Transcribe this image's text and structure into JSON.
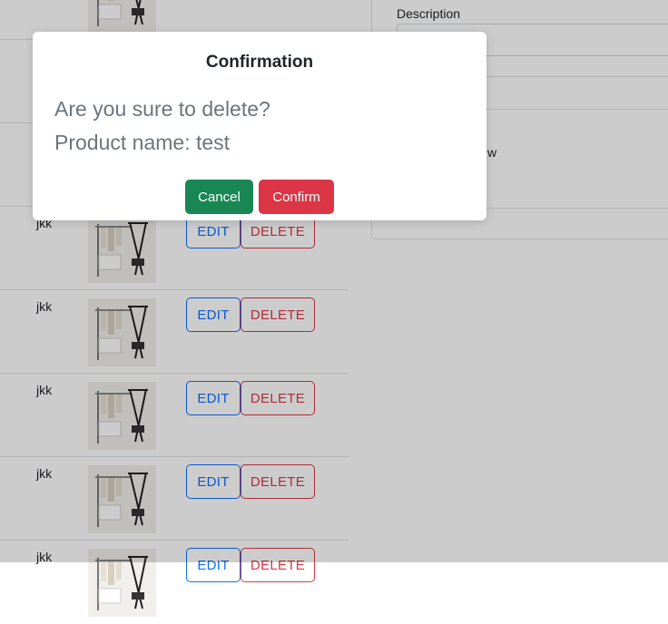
{
  "form": {
    "description_label": "Description",
    "fragment": "w"
  },
  "products": [
    {
      "name": "",
      "edit_label": "",
      "delete_label": ""
    },
    {
      "name": "",
      "edit_label": "",
      "delete_label": ""
    },
    {
      "name": "",
      "edit_label": "",
      "delete_label": ""
    },
    {
      "name": "jkk",
      "edit_label": "EDIT",
      "delete_label": "DELETE"
    },
    {
      "name": "jkk",
      "edit_label": "EDIT",
      "delete_label": "DELETE"
    },
    {
      "name": "jkk",
      "edit_label": "EDIT",
      "delete_label": "DELETE"
    },
    {
      "name": "jkk",
      "edit_label": "EDIT",
      "delete_label": "DELETE"
    },
    {
      "name": "jkk",
      "edit_label": "EDIT",
      "delete_label": "DELETE"
    }
  ],
  "modal": {
    "title": "Confirmation",
    "question": "Are you sure to delete?",
    "product_line": "Product name: test",
    "cancel_label": "Cancel",
    "confirm_label": "Confirm"
  },
  "colors": {
    "primary": "#0d6efd",
    "danger": "#dc3545",
    "success": "#198754"
  }
}
